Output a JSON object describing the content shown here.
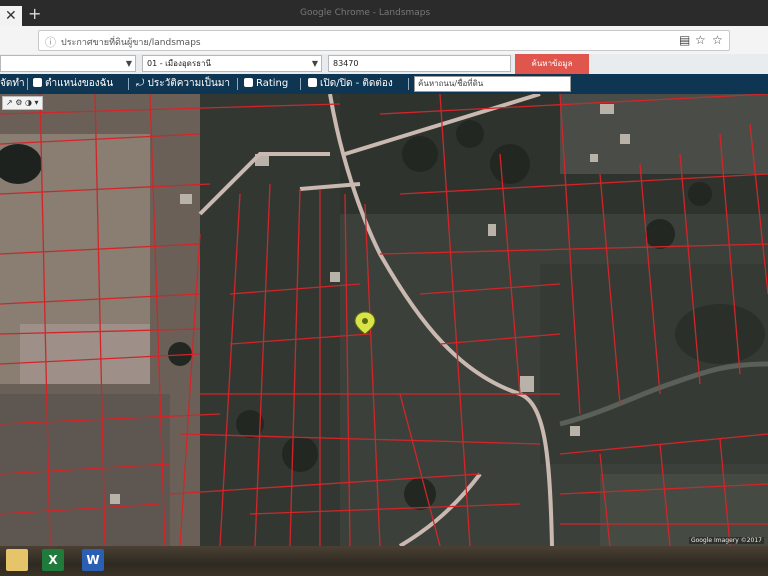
{
  "browser": {
    "tab_close_glyph": "✕",
    "new_tab_glyph": "+",
    "tab_title": "Google Chrome - Landsmaps",
    "secure_glyph": "ⓘ",
    "url": "ประกาศขายที่ดินผู้ขาย/landsmaps",
    "reader_glyph": "▤",
    "bookmark_glyph": "☆",
    "star_glyph": "☆"
  },
  "selectors": {
    "province": "",
    "district": "01 - เมืองอุดรธานี",
    "parcel_no": "83470",
    "search_label": "ค้นหาข้อมูล"
  },
  "toolbar": {
    "item_1": "จัดทำ",
    "item_2": "ตำแหน่งของฉัน",
    "item_3": "ประวัติความเป็นมา",
    "item_4": "Rating",
    "item_5": "เปิด/ปิด - ติดต่อง",
    "input_placeholder": "ค้นหาถนน/ชื่อที่ดิน"
  },
  "map": {
    "controls": "↗ ⚙ ◑ ▾",
    "attribution": "Google Imagery ©2017",
    "pin_icon": "map-pin-icon"
  },
  "taskbar": {
    "excel_label": "X",
    "word_label": "W"
  }
}
